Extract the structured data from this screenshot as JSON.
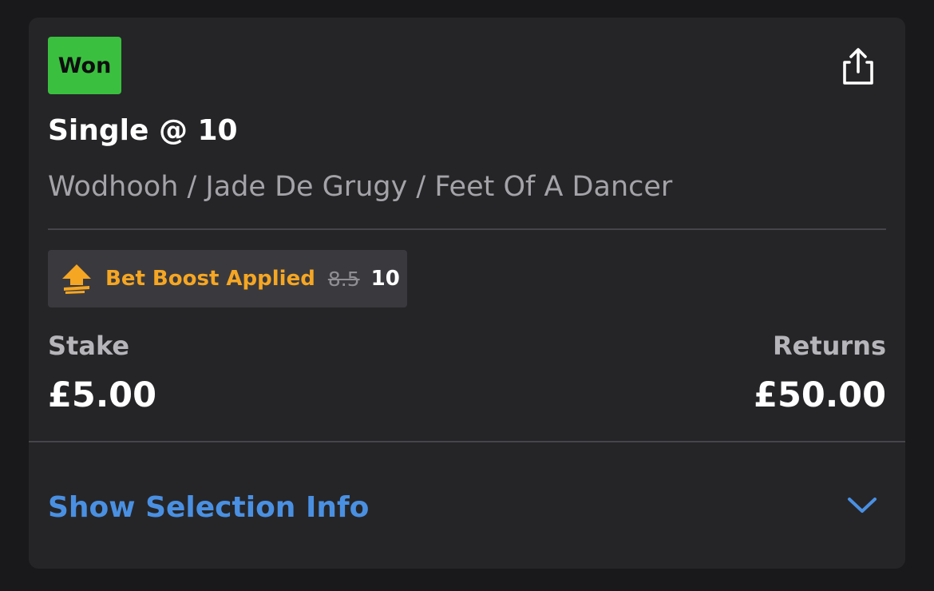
{
  "bet": {
    "status": "Won",
    "title": "Single @ 10",
    "selections": "Wodhooh / Jade De Grugy / Feet Of A Dancer"
  },
  "boost": {
    "label": "Bet Boost Applied",
    "old_odds": "8.5",
    "new_odds": "10",
    "icon": "boost-arrow-icon"
  },
  "stake": {
    "label": "Stake",
    "value": "£5.00"
  },
  "returns": {
    "label": "Returns",
    "value": "£50.00"
  },
  "actions": {
    "share_icon": "share-icon",
    "show_selection_info": "Show Selection Info",
    "chevron_icon": "chevron-down-icon"
  },
  "colors": {
    "background": "#19191b",
    "card": "#252528",
    "won_badge": "#3bbf3f",
    "boost_accent": "#f5a623",
    "link": "#4a90e2"
  }
}
